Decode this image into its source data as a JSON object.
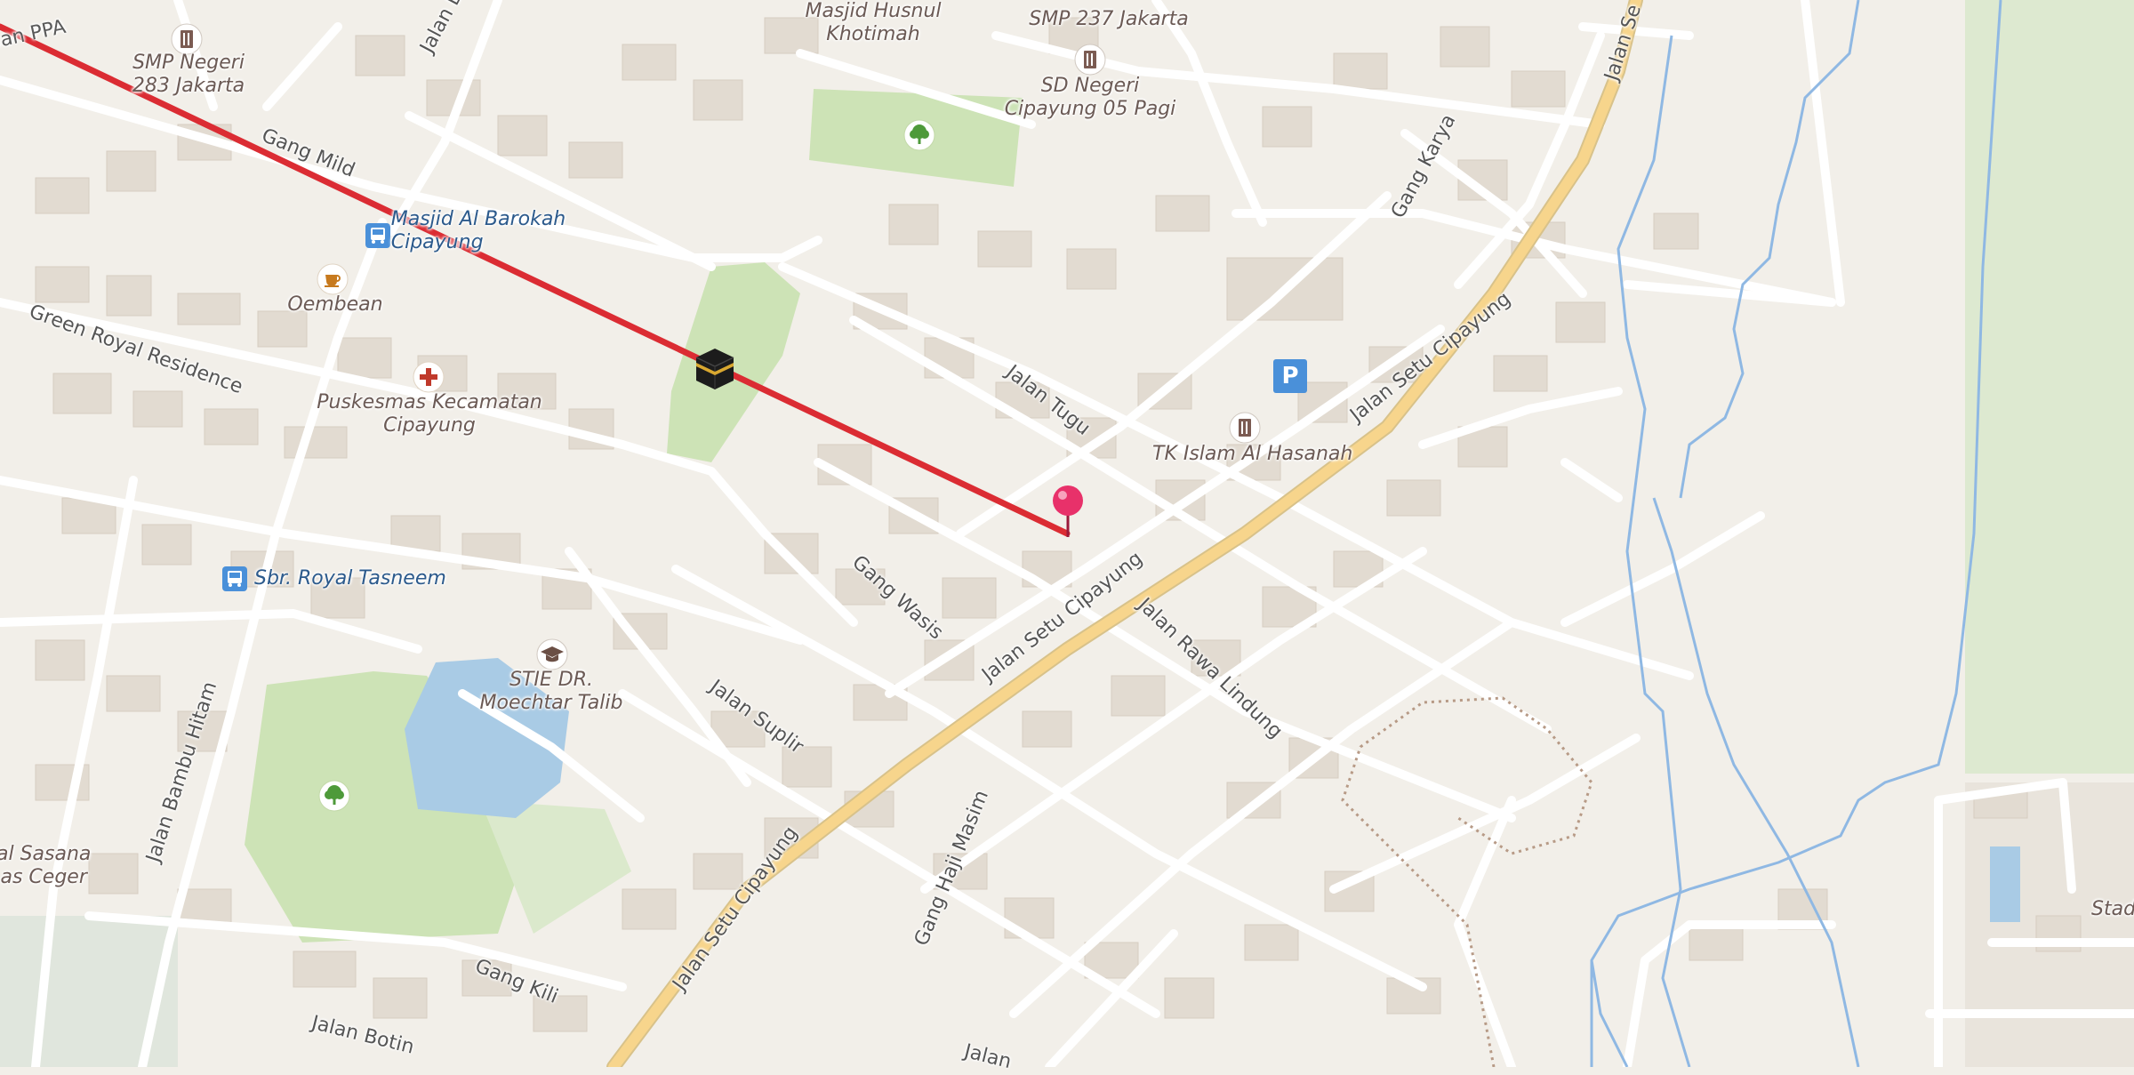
{
  "map": {
    "route_color": "#db2c33",
    "road_major_color": "#f7d58c",
    "road_minor_color": "#ffffff",
    "park_color": "#cde3b6",
    "water_color": "#a9cbe5",
    "land_color": "#f2efe9"
  },
  "labels": {
    "ppa": "lan PPA",
    "smp283_l1": "SMP Negeri",
    "smp283_l2": "283 Jakarta",
    "jalan_bam": "Jalan Bam",
    "gang_mild": "Gang Mild",
    "masjid_l1": "Masjid Al Barokah",
    "masjid_l2": "Cipayung",
    "oembean": "Oembean",
    "green_royal": "Green Royal Residence",
    "puskesmas_l1": "Puskesmas Kecamatan",
    "puskesmas_l2": "Cipayung",
    "sbr_royal": "Sbr. Royal Tasneem",
    "stie_l1": "STIE DR.",
    "stie_l2": "Moechtar Talib",
    "jalan_bambu": "Jalan Bambu Hitam",
    "sasana_l1": "al Sasana",
    "sasana_l2": "as Ceger",
    "gang_kili": "Gang Kili",
    "jalan_botin": "Jalan Botin",
    "masjid_husnul_l1": "Masjid Husnul",
    "masjid_husnul_l2": "Khotimah",
    "smp237": "SMP 237 Jakarta",
    "sd_l1": "SD Negeri",
    "sd_l2": "Cipayung 05 Pagi",
    "gang_karya": "Gang Karya",
    "jalan_tugu": "Jalan Tugu",
    "tk_islam": "TK Islam Al Hasanah",
    "setu_1": "Jalan Setu Cipayung",
    "setu_2": "Jalan Setu Cipayung",
    "setu_3": "Jalan Setu Cipayung",
    "setu_4": "Jalan Se",
    "gang_wasis": "Gang Wasis",
    "jalan_suplir": "Jalan Suplir",
    "rawa_lindung": "Jalan Rawa Lindung",
    "gang_haji": "Gang Haji Masim",
    "jalan_bottom": "Jalan",
    "stadium": "Stadiu",
    "parking": "P"
  },
  "icons": {
    "school": "school-icon",
    "bus": "bus-stop-icon",
    "cafe": "cafe-icon",
    "hospital": "hospital-icon",
    "university": "university-icon",
    "tree": "tree-icon",
    "parking": "parking-icon",
    "kaaba": "kaaba-icon",
    "pin": "location-pin-icon"
  }
}
